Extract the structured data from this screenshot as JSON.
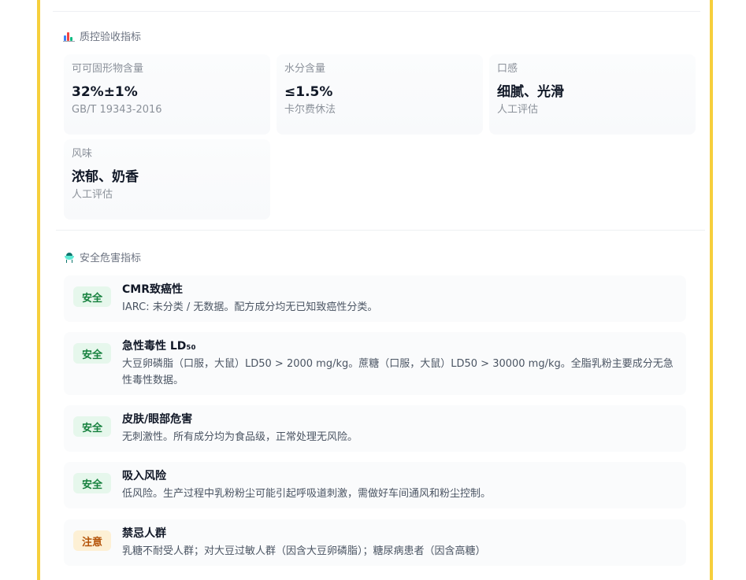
{
  "qc_section": {
    "icon": "bar-chart-icon",
    "title": "质控验收指标",
    "items": [
      {
        "label": "可可固形物含量",
        "value": "32%±1%",
        "method": "GB/T 19343-2016"
      },
      {
        "label": "水分含量",
        "value": "≤1.5%",
        "method": "卡尔费休法"
      },
      {
        "label": "口感",
        "value": "细腻、光滑",
        "method": "人工评估"
      },
      {
        "label": "风味",
        "value": "浓郁、奶香",
        "method": "人工评估"
      }
    ]
  },
  "safety_section": {
    "icon": "hazard-icon",
    "title": "安全危害指标",
    "items": [
      {
        "badge": "安全",
        "status": "safe",
        "title": "CMR致癌性",
        "desc": "IARC: 未分类 / 无数据。配方成分均无已知致癌性分类。"
      },
      {
        "badge": "安全",
        "status": "safe",
        "title": "急性毒性 LD₅₀",
        "desc": "大豆卵磷脂（口服，大鼠）LD50 > 2000 mg/kg。蔗糖（口服，大鼠）LD50 > 30000 mg/kg。全脂乳粉主要成分无急性毒性数据。"
      },
      {
        "badge": "安全",
        "status": "safe",
        "title": "皮肤/眼部危害",
        "desc": "无刺激性。所有成分均为食品级，正常处理无风险。"
      },
      {
        "badge": "安全",
        "status": "safe",
        "title": "吸入风险",
        "desc": "低风险。生产过程中乳粉粉尘可能引起呼吸道刺激，需做好车间通风和粉尘控制。"
      },
      {
        "badge": "注意",
        "status": "warn",
        "title": "禁忌人群",
        "desc": "乳糖不耐受人群；对大豆过敏人群（因含大豆卵磷脂）；糖尿病患者（因含高糖）"
      }
    ]
  },
  "colors": {
    "frame_border": "#f6cf3c",
    "safe_badge_bg": "#e6f7ec",
    "safe_badge_text": "#15803d",
    "warn_badge_bg": "#fdf0d5",
    "warn_badge_text": "#b45309"
  }
}
